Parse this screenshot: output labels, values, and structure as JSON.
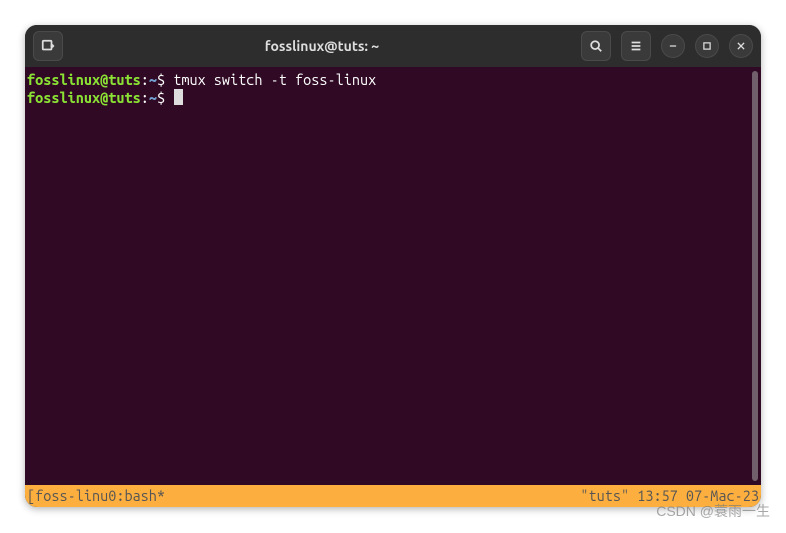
{
  "titlebar": {
    "title": "fosslinux@tuts: ~"
  },
  "prompt": {
    "user": "fosslinux",
    "at": "@",
    "host": "tuts",
    "colon": ":",
    "path": "~",
    "symbol": "$"
  },
  "lines": {
    "line1_command": "tmux switch -t foss-linux",
    "line2_command": ""
  },
  "statusbar": {
    "left": "[foss-linu0:bash*",
    "right": "\"tuts\" 13:57 07-Mac-23"
  },
  "watermark": "CSDN @蓑雨一生",
  "icons": {
    "new_tab": "new-tab-icon",
    "search": "search-icon",
    "menu": "hamburger-icon",
    "minimize": "minimize-icon",
    "maximize": "maximize-icon",
    "close": "close-icon"
  }
}
